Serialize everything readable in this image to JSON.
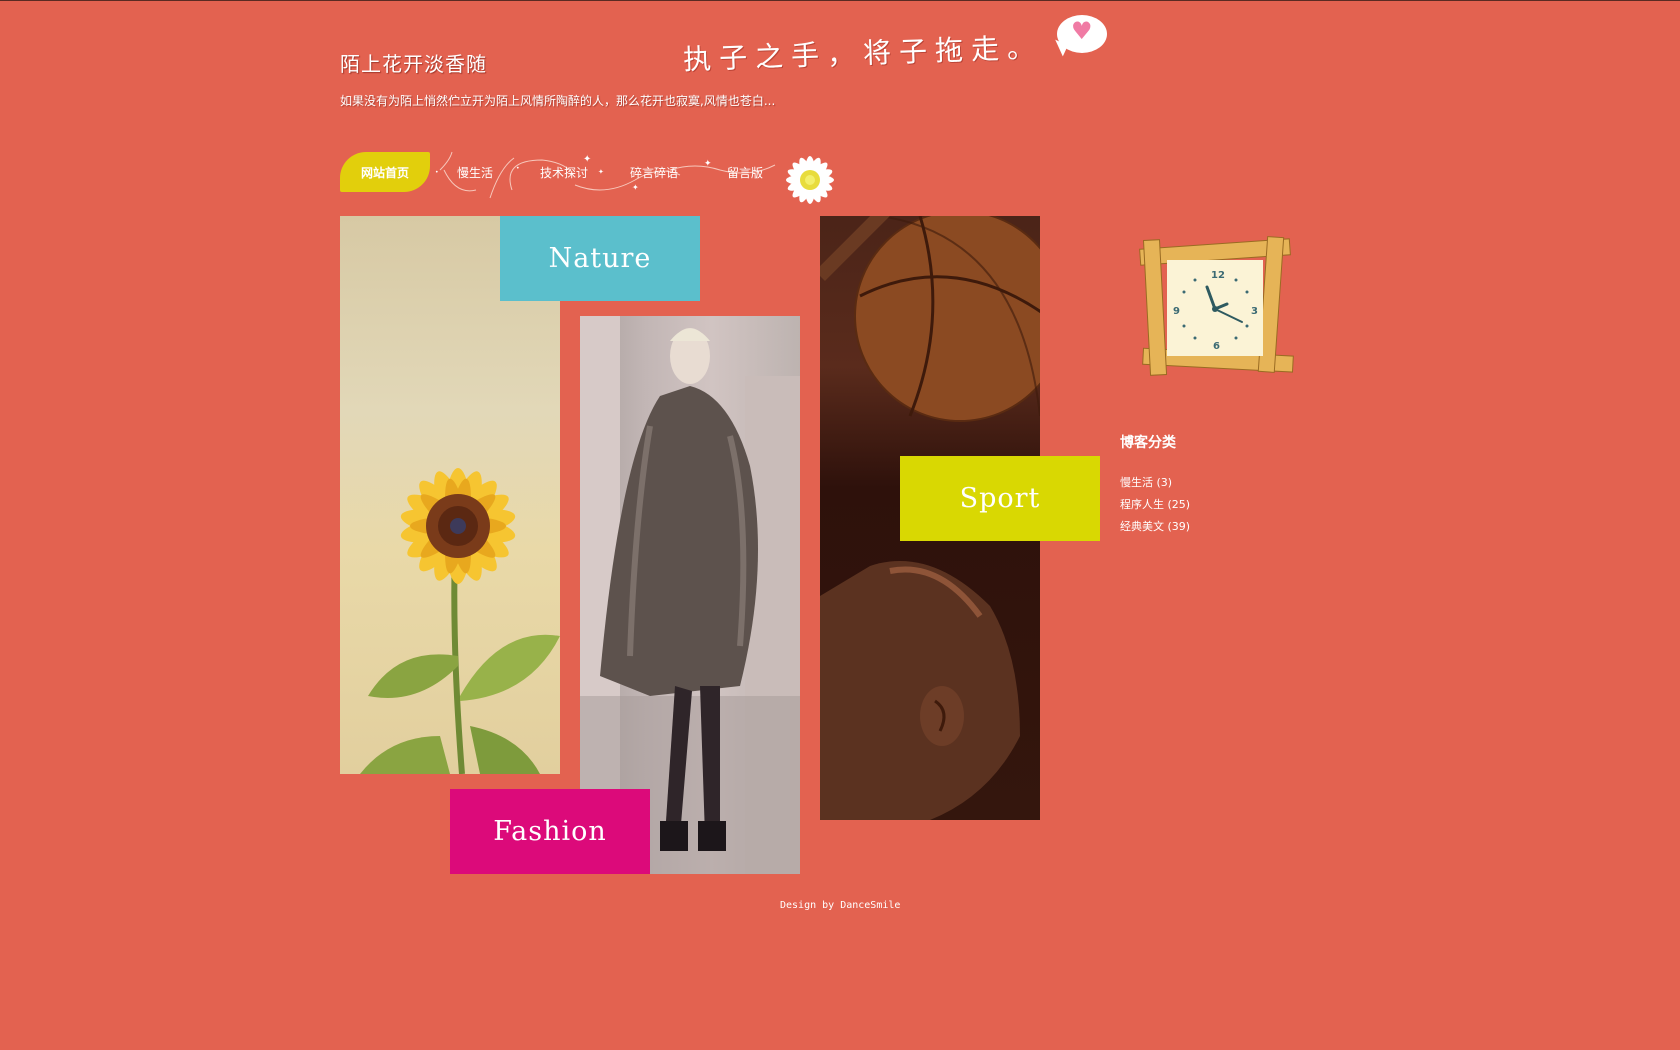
{
  "header": {
    "title": "陌上花开淡香随",
    "description": "如果没有为陌上悄然伫立开为陌上风情所陶醉的人，那么花开也寂寞,风情也苍白...",
    "slogan": "执子之手，将子拖走。"
  },
  "nav": {
    "items": [
      {
        "label": "网站首页",
        "active": true
      },
      {
        "label": "慢生活"
      },
      {
        "label": "技术探讨"
      },
      {
        "label": "碎言碎语"
      },
      {
        "label": "留言版"
      }
    ]
  },
  "gallery": {
    "nature_label": "Nature",
    "fashion_label": "Fashion",
    "sport_label": "Sport"
  },
  "sidebar": {
    "title": "博客分类",
    "categories": [
      {
        "label": "慢生活 (3)"
      },
      {
        "label": "程序人生 (25)"
      },
      {
        "label": "经典美文 (39)"
      }
    ]
  },
  "footer": {
    "text": "Design by DanceSmile"
  },
  "colors": {
    "background": "#e36250",
    "nature": "#5bbfcc",
    "sport": "#d9d802",
    "fashion": "#dc0a7a",
    "nav_active": "#e2cf0c"
  },
  "icons": [
    "heart-icon",
    "daisy-flower-icon",
    "wooden-clock-icon"
  ]
}
